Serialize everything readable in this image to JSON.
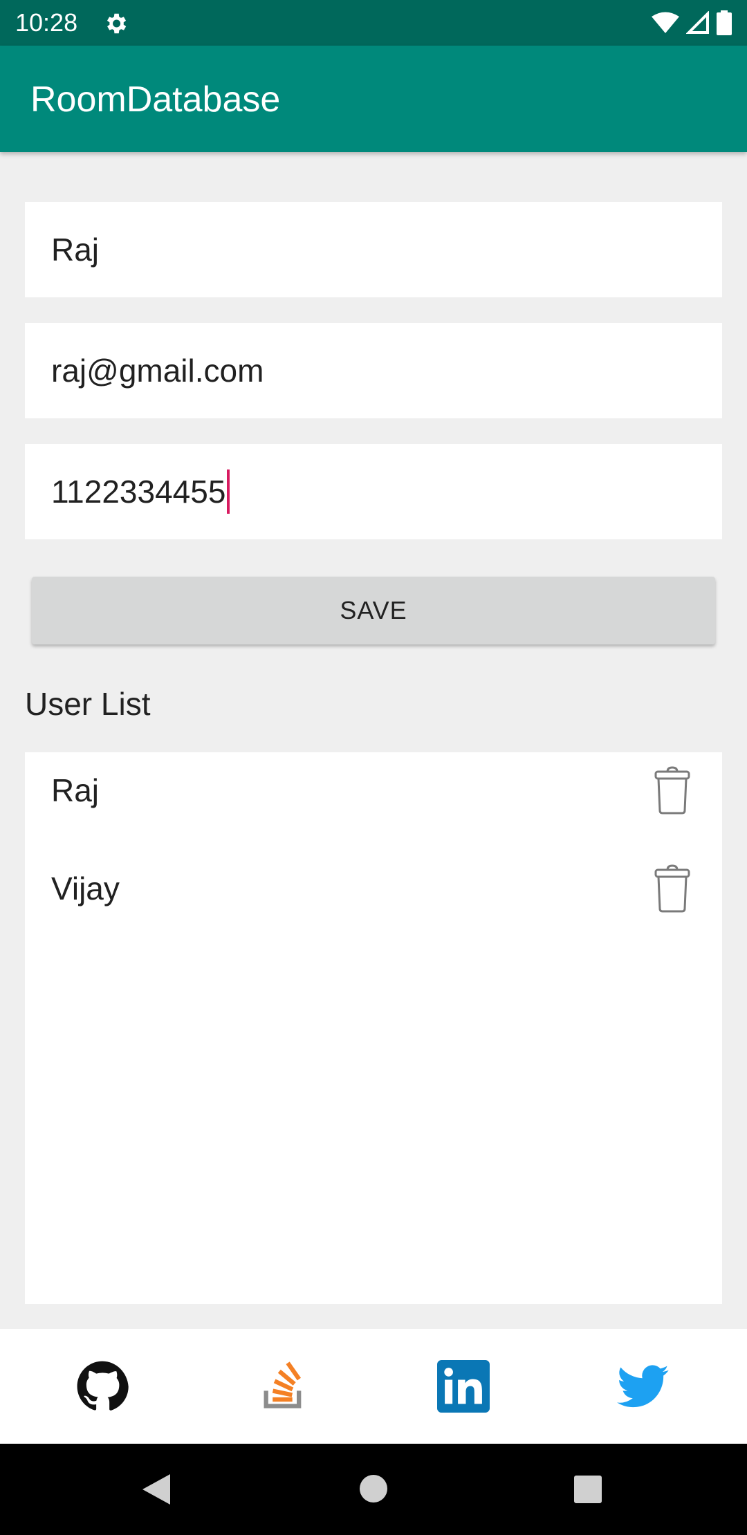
{
  "status_bar": {
    "time": "10:28",
    "icons": [
      "gear-icon",
      "wifi-icon",
      "signal-icon",
      "battery-icon"
    ]
  },
  "app_bar": {
    "title": "RoomDatabase"
  },
  "form": {
    "name_value": "Raj",
    "email_value": "raj@gmail.com",
    "phone_value": "1122334455",
    "save_label": "SAVE"
  },
  "user_list": {
    "label": "User List",
    "items": [
      {
        "name": "Raj"
      },
      {
        "name": "Vijay"
      }
    ]
  },
  "social": [
    "github-icon",
    "stackoverflow-icon",
    "linkedin-icon",
    "twitter-icon"
  ],
  "colors": {
    "status_bar": "#00685b",
    "app_bar": "#00897b",
    "cursor": "#d81b60",
    "stackoverflow": "#f48024",
    "linkedin": "#0a77b5",
    "twitter": "#1da1f2"
  }
}
